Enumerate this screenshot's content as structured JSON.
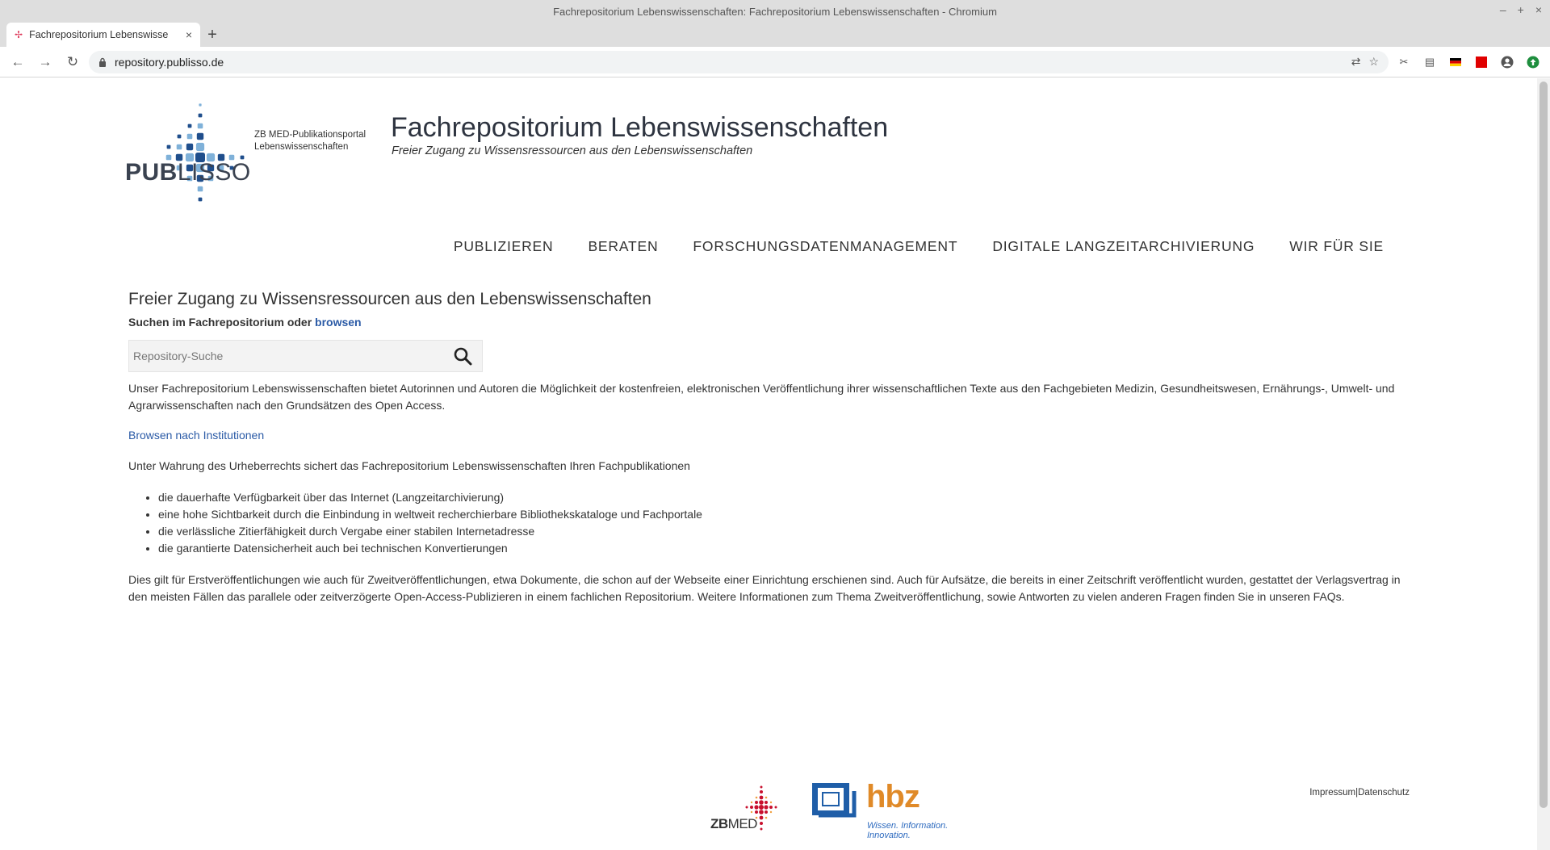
{
  "window": {
    "title": "Fachrepositorium Lebenswissenschaften: Fachrepositorium Lebenswissenschaften - Chromium",
    "controls": [
      "–",
      "+",
      "×"
    ]
  },
  "tab": {
    "label": "Fachrepositorium Lebenswisse",
    "close": "×",
    "new_tab": "+"
  },
  "toolbar": {
    "url": "repository.publisso.de"
  },
  "header": {
    "logo_text_bold": "PUB",
    "logo_text_light": "LISSO",
    "logo_sub_line1": "ZB MED-Publikationsportal",
    "logo_sub_line2": "Lebenswissenschaften",
    "title": "Fachrepositorium Lebenswissenschaften",
    "subtitle": "Freier Zugang zu Wissensressourcen aus den Lebenswissenschaften"
  },
  "nav": {
    "items": [
      {
        "label": "PUBLIZIEREN"
      },
      {
        "label": "BERATEN"
      },
      {
        "label": "FORSCHUNGSDATENMANAGEMENT"
      },
      {
        "label": "DIGITALE LANGZEITARCHIVIERUNG"
      },
      {
        "label": "WIR FÜR SIE"
      }
    ]
  },
  "main": {
    "heading": "Freier Zugang zu Wissensressourcen aus den Lebenswissenschaften",
    "search_intro": "Suchen im Fachrepositorium oder ",
    "browse_link": "browsen",
    "search_placeholder": "Repository-Suche",
    "intro_paragraph": "Unser Fachrepositorium Lebenswissenschaften bietet Autorinnen und Autoren die Möglichkeit der kostenfreien, elektronischen Veröffentlichung ihrer wissenschaftlichen Texte aus den Fachgebieten Medizin, Gesundheitswesen, Ernährungs-, Umwelt- und Agrarwissenschaften nach den Grundsätzen des Open Access.",
    "institutions_link": "Browsen nach Institutionen",
    "copyright_paragraph": "Unter Wahrung des Urheberrechts sichert das Fachrepositorium Lebenswissenschaften Ihren Fachpublikationen",
    "bullets": [
      "die dauerhafte Verfügbarkeit über das Internet (Langzeitarchivierung)",
      "eine hohe Sichtbarkeit durch die Einbindung in weltweit recherchierbare Bibliothekskataloge und Fachportale",
      "die verlässliche Zitierfähigkeit durch Vergabe einer stabilen Internetadresse",
      "die garantierte Datensicherheit auch bei technischen Konvertierungen"
    ],
    "closing_paragraph": "Dies gilt für Erstveröffentlichungen wie auch für Zweitveröffentlichungen, etwa Dokumente, die schon auf der Webseite einer Einrichtung erschienen sind. Auch für Aufsätze, die bereits in einer Zeitschrift veröffentlicht wurden, gestattet der Verlagsvertrag in den meisten Fällen das parallele oder zeitverzögerte Open-Access-Publizieren in einem fachlichen Repositorium. Weitere Informationen zum Thema Zweitveröffentlichung, sowie Antworten zu vielen anderen Fragen finden Sie in unseren FAQs."
  },
  "footer": {
    "zbmed_bold": "ZB",
    "zbmed_light": "MED",
    "hbz_text": "hbz",
    "hbz_tagline": "Wissen. Information. Innovation.",
    "impressum": "Impressum",
    "separator": "|",
    "datenschutz": "Datenschutz"
  },
  "colors": {
    "link": "#2a5aa6",
    "hbz_orange": "#e08a28",
    "hbz_blue": "#2e6bbf",
    "logo_dark_blue": "#1f4e8c",
    "logo_light_blue": "#7fb1d9"
  }
}
